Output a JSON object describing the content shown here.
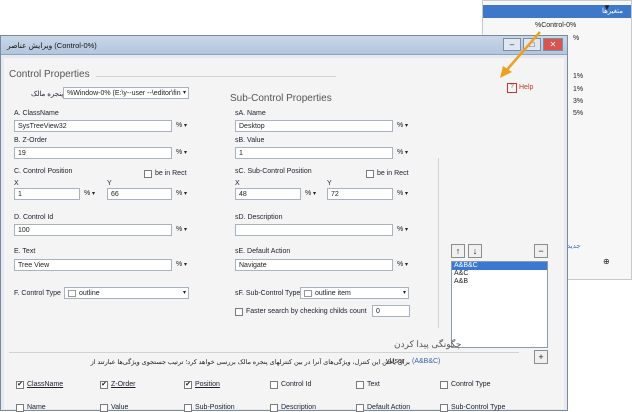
{
  "bg_panel": {
    "header": "متغیرها",
    "filter_icon": "▼",
    "tree_item": "%Control-0%",
    "percents": [
      "%",
      "1%",
      "1%",
      "3%",
      "5%"
    ],
    "bottom_link": "جدید",
    "zoom_icon": "⊕"
  },
  "dialog": {
    "title": "ویرایش عناصر (Control-0%)",
    "minimize": "–",
    "maximize": "□",
    "close": "✕"
  },
  "control_properties": {
    "title": "Control Properties",
    "owner_window_label": "پنجره مالک",
    "owner_window_value": "%Window-0% (E:\\y--user --\\editor\\fin",
    "help_label": "Help",
    "classname_label": "A. ClassName",
    "classname_value": "SysTreeView32",
    "zorder_label": "B. Z-Order",
    "zorder_value": "19",
    "position_label": "C. Control Position",
    "be_in_rect": "be in Rect",
    "x_label": "X",
    "y_label": "Y",
    "x_value": "1",
    "y_value": "66",
    "controlid_label": "D. Control Id",
    "controlid_value": "100",
    "text_label": "E. Text",
    "text_value": "Tree View",
    "controltype_label": "F. Control Type",
    "controltype_value": "outline",
    "pct": "%"
  },
  "subcontrol_properties": {
    "title": "Sub-Control Properties",
    "name_label": "sA. Name",
    "name_value": "Desktop",
    "value_label": "sB. Value",
    "value_value": "1",
    "position_label": "sC. Sub-Control Position",
    "be_in_rect": "be in Rect",
    "x_value": "48",
    "y_value": "72",
    "description_label": "sD. Description",
    "description_value": "",
    "default_action_label": "sE. Default Action",
    "default_action_value": "Navigate",
    "type_label": "sF. Sub-Control Type",
    "type_value": "outline item",
    "faster_search": "Faster search by checking childs count",
    "faster_value": "0"
  },
  "order_list": {
    "up": "↑",
    "down": "↓",
    "remove": "−",
    "add": "+",
    "items": [
      "A&B&C",
      "A&C",
      "A&B"
    ]
  },
  "search_section": {
    "title": "چگونگی پیدا کردن",
    "description": "برای یافتن این کنترل، ویژگی‌های آنرا در بین کنترلهای پنجره مالک بررسی خواهد کرد؛ ترتیب جستجوی ویژگی‌ها عبارتند از",
    "vuser": "vUser",
    "formula": "(A&B&C)",
    "checks": [
      {
        "label": "ClassName",
        "checked": true
      },
      {
        "label": "Z-Order",
        "checked": true
      },
      {
        "label": "Position",
        "checked": true
      },
      {
        "label": "Control Id",
        "checked": false
      },
      {
        "label": "Text",
        "checked": false
      },
      {
        "label": "Control Type",
        "checked": false
      },
      {
        "label": "Name",
        "checked": false
      },
      {
        "label": "Value",
        "checked": false
      },
      {
        "label": "Sub-Position",
        "checked": false
      },
      {
        "label": "Description",
        "checked": false
      },
      {
        "label": "Default Action",
        "checked": false
      },
      {
        "label": "Sub-Control Type",
        "checked": false
      }
    ]
  },
  "colors": {
    "accent_blue": "#3b79d0",
    "arrow_orange": "#f0a020",
    "help_red": "#c0392b"
  }
}
